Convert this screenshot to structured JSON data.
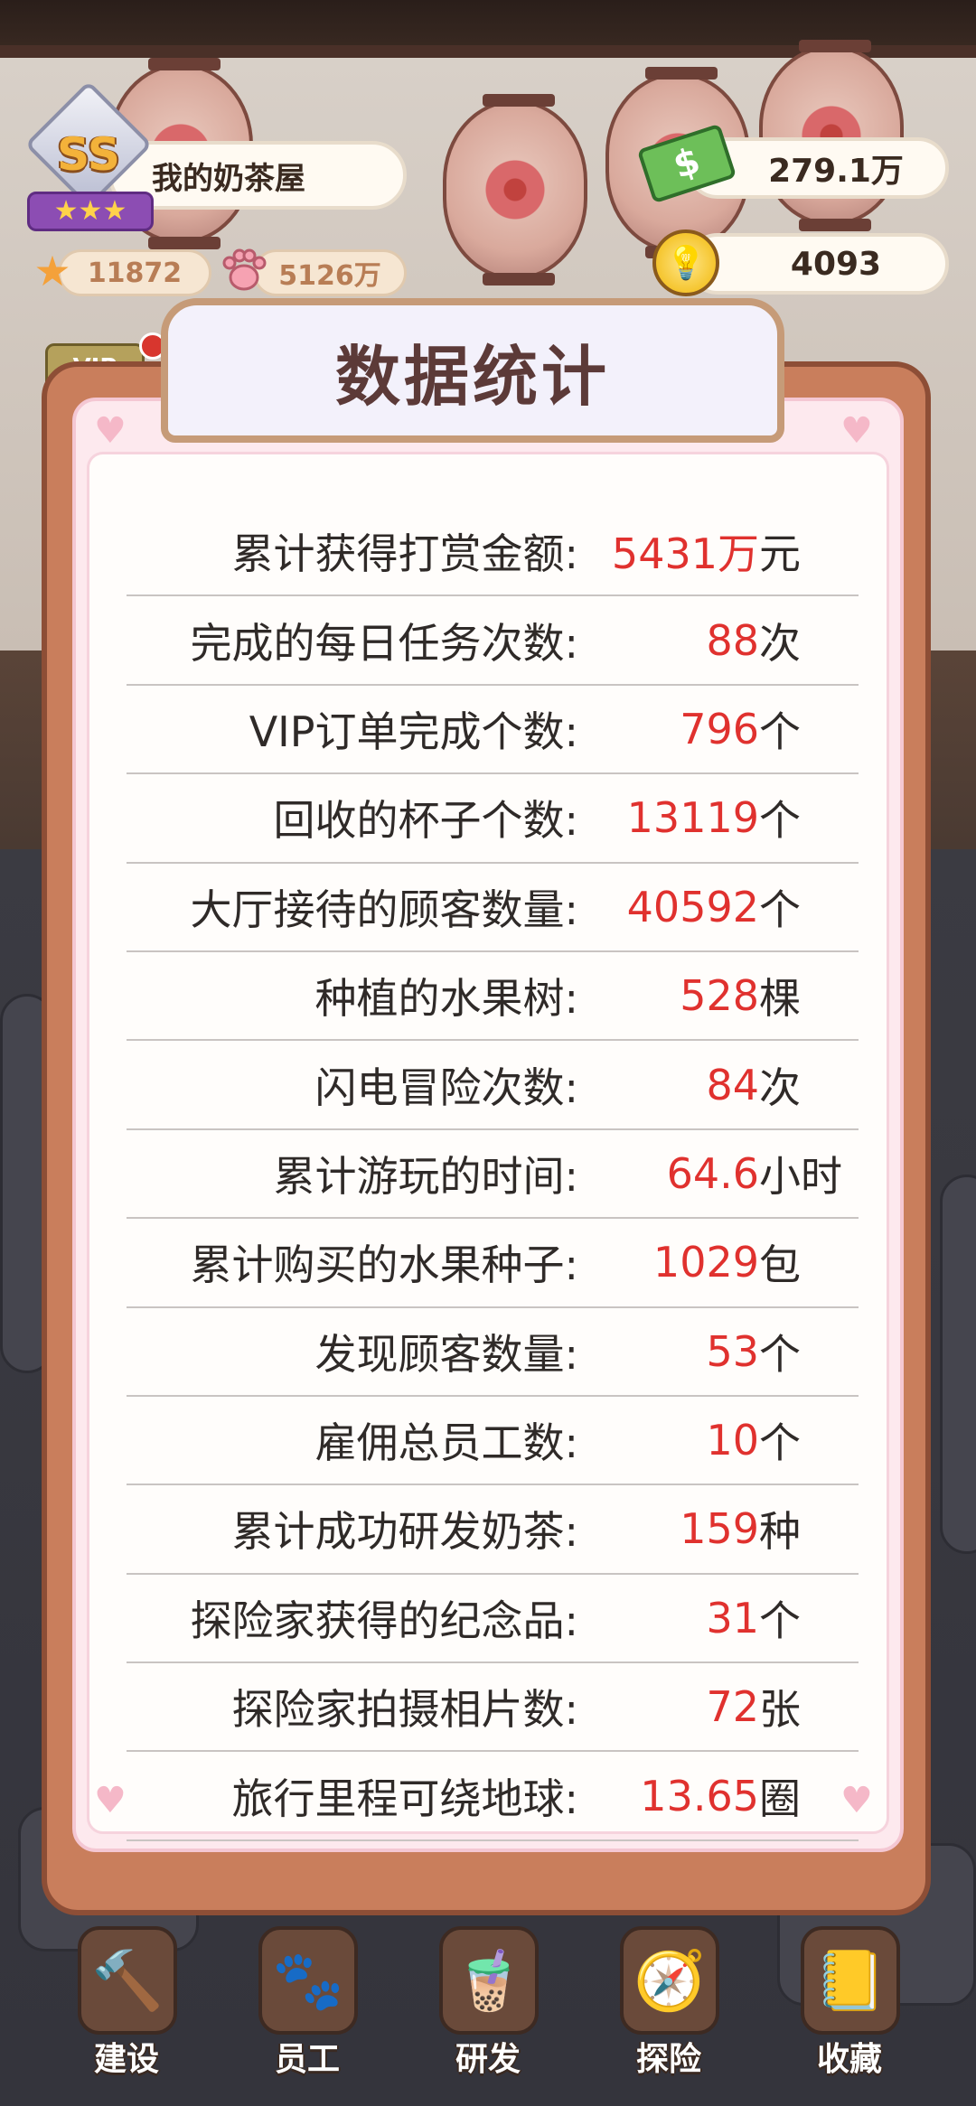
{
  "hud": {
    "rank": "SS",
    "rank_stars": "★★★",
    "shop_name": "我的奶茶屋",
    "stars": "11872",
    "paw": "5126万",
    "money": "279.1万",
    "ideas": "4093",
    "vip_label": "VIP"
  },
  "panel": {
    "title": "数据统计",
    "stats": [
      {
        "label": "累计获得打赏金额:",
        "value": "5431万",
        "unit": "元"
      },
      {
        "label": "完成的每日任务次数:",
        "value": "88",
        "unit": "次"
      },
      {
        "label": "VIP订单完成个数:",
        "value": "796",
        "unit": "个"
      },
      {
        "label": "回收的杯子个数:",
        "value": "13119",
        "unit": "个"
      },
      {
        "label": "大厅接待的顾客数量:",
        "value": "40592",
        "unit": "个"
      },
      {
        "label": "种植的水果树:",
        "value": "528",
        "unit": "棵"
      },
      {
        "label": "闪电冒险次数:",
        "value": "84",
        "unit": "次"
      },
      {
        "label": "累计游玩的时间:",
        "value": "64.6",
        "unit": "小时"
      },
      {
        "label": "累计购买的水果种子:",
        "value": "1029",
        "unit": "包"
      },
      {
        "label": "发现顾客数量:",
        "value": "53",
        "unit": "个"
      },
      {
        "label": "雇佣总员工数:",
        "value": "10",
        "unit": "个"
      },
      {
        "label": "累计成功研发奶茶:",
        "value": "159",
        "unit": "种"
      },
      {
        "label": "探险家获得的纪念品:",
        "value": "31",
        "unit": "个"
      },
      {
        "label": "探险家拍摄相片数:",
        "value": "72",
        "unit": "张"
      },
      {
        "label": "旅行里程可绕地球:",
        "value": "13.65",
        "unit": "圈"
      }
    ]
  },
  "nav": [
    {
      "label": "建设",
      "icon": "hammer-icon"
    },
    {
      "label": "员工",
      "icon": "paw-icon"
    },
    {
      "label": "研发",
      "icon": "milk-tea-icon"
    },
    {
      "label": "探险",
      "icon": "compass-icon"
    },
    {
      "label": "收藏",
      "icon": "album-icon"
    }
  ],
  "colors": {
    "value_red": "#e0312e",
    "board_brown": "#c97e5c",
    "paper_pink": "#fde9ee",
    "title_text": "#5c3a38"
  }
}
